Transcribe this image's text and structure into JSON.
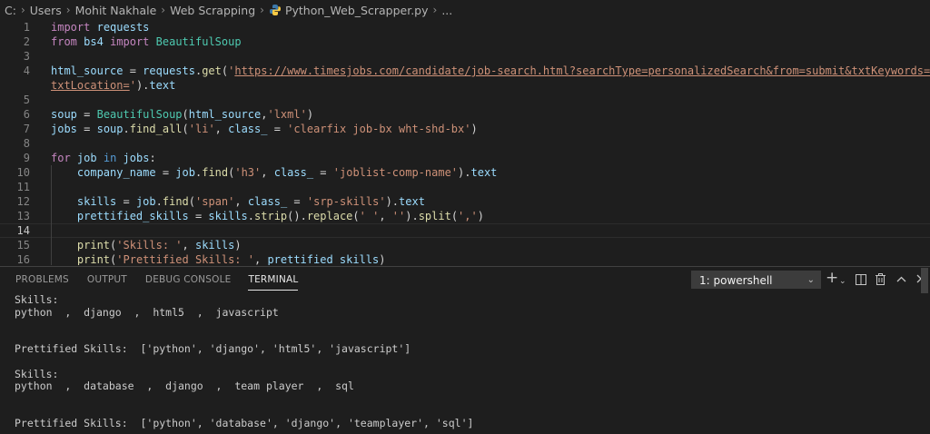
{
  "breadcrumb": {
    "segments": [
      "C:",
      "Users",
      "Mohit Nakhale",
      "Web Scrapping",
      "Python_Web_Scrapper.py",
      "..."
    ]
  },
  "editor": {
    "active_line": 14,
    "lines": [
      {
        "n": "1",
        "t": [
          [
            "k",
            "import"
          ],
          [
            "p",
            " "
          ],
          [
            "v",
            "requests"
          ]
        ]
      },
      {
        "n": "2",
        "t": [
          [
            "k",
            "from"
          ],
          [
            "p",
            " "
          ],
          [
            "v",
            "bs4"
          ],
          [
            "p",
            " "
          ],
          [
            "k",
            "import"
          ],
          [
            "p",
            " "
          ],
          [
            "c",
            "BeautifulSoup"
          ]
        ]
      },
      {
        "n": "3",
        "t": []
      },
      {
        "n": "4",
        "t": [
          [
            "v",
            "html_source"
          ],
          [
            "p",
            " = "
          ],
          [
            "v",
            "requests"
          ],
          [
            "p",
            "."
          ],
          [
            "f",
            "get"
          ],
          [
            "p",
            "("
          ],
          [
            "s",
            "'"
          ],
          [
            "su",
            "https://www.timesjobs.com/candidate/job-search.html?searchType=personalizedSearch&from=submit&txtKeywords=Python&"
          ]
        ]
      },
      {
        "n": "",
        "t": [
          [
            "su",
            "txtLocation="
          ],
          [
            "s",
            "'"
          ],
          [
            "p",
            ")."
          ],
          [
            "v",
            "text"
          ]
        ]
      },
      {
        "n": "5",
        "t": []
      },
      {
        "n": "6",
        "t": [
          [
            "v",
            "soup"
          ],
          [
            "p",
            " = "
          ],
          [
            "c",
            "BeautifulSoup"
          ],
          [
            "p",
            "("
          ],
          [
            "v",
            "html_source"
          ],
          [
            "p",
            ","
          ],
          [
            "s",
            "'lxml'"
          ],
          [
            "p",
            ")"
          ]
        ]
      },
      {
        "n": "7",
        "t": [
          [
            "v",
            "jobs"
          ],
          [
            "p",
            " = "
          ],
          [
            "v",
            "soup"
          ],
          [
            "p",
            "."
          ],
          [
            "f",
            "find_all"
          ],
          [
            "p",
            "("
          ],
          [
            "s",
            "'li'"
          ],
          [
            "p",
            ", "
          ],
          [
            "v",
            "class_"
          ],
          [
            "p",
            " = "
          ],
          [
            "s",
            "'clearfix job-bx wht-shd-bx'"
          ],
          [
            "p",
            ")"
          ]
        ]
      },
      {
        "n": "8",
        "t": []
      },
      {
        "n": "9",
        "t": [
          [
            "k",
            "for"
          ],
          [
            "p",
            " "
          ],
          [
            "v",
            "job"
          ],
          [
            "p",
            " "
          ],
          [
            "kb",
            "in"
          ],
          [
            "p",
            " "
          ],
          [
            "v",
            "jobs"
          ],
          [
            "p",
            ":"
          ]
        ]
      },
      {
        "n": "10",
        "t": [
          [
            "p",
            "    "
          ],
          [
            "v",
            "company_name"
          ],
          [
            "p",
            " = "
          ],
          [
            "v",
            "job"
          ],
          [
            "p",
            "."
          ],
          [
            "f",
            "find"
          ],
          [
            "p",
            "("
          ],
          [
            "s",
            "'h3'"
          ],
          [
            "p",
            ", "
          ],
          [
            "v",
            "class_"
          ],
          [
            "p",
            " = "
          ],
          [
            "s",
            "'joblist-comp-name'"
          ],
          [
            "p",
            ")."
          ],
          [
            "v",
            "text"
          ]
        ]
      },
      {
        "n": "11",
        "t": []
      },
      {
        "n": "12",
        "t": [
          [
            "p",
            "    "
          ],
          [
            "v",
            "skills"
          ],
          [
            "p",
            " = "
          ],
          [
            "v",
            "job"
          ],
          [
            "p",
            "."
          ],
          [
            "f",
            "find"
          ],
          [
            "p",
            "("
          ],
          [
            "s",
            "'span'"
          ],
          [
            "p",
            ", "
          ],
          [
            "v",
            "class_"
          ],
          [
            "p",
            " = "
          ],
          [
            "s",
            "'srp-skills'"
          ],
          [
            "p",
            ")."
          ],
          [
            "v",
            "text"
          ]
        ]
      },
      {
        "n": "13",
        "t": [
          [
            "p",
            "    "
          ],
          [
            "v",
            "prettified_skills"
          ],
          [
            "p",
            " = "
          ],
          [
            "v",
            "skills"
          ],
          [
            "p",
            "."
          ],
          [
            "f",
            "strip"
          ],
          [
            "p",
            "()."
          ],
          [
            "f",
            "replace"
          ],
          [
            "p",
            "("
          ],
          [
            "s",
            "' '"
          ],
          [
            "p",
            ", "
          ],
          [
            "s",
            "''"
          ],
          [
            "p",
            ")."
          ],
          [
            "f",
            "split"
          ],
          [
            "p",
            "("
          ],
          [
            "s",
            "','"
          ],
          [
            "p",
            ")"
          ]
        ]
      },
      {
        "n": "14",
        "t": []
      },
      {
        "n": "15",
        "t": [
          [
            "p",
            "    "
          ],
          [
            "f",
            "print"
          ],
          [
            "p",
            "("
          ],
          [
            "s",
            "'Skills: '"
          ],
          [
            "p",
            ", "
          ],
          [
            "v",
            "skills"
          ],
          [
            "p",
            ")"
          ]
        ]
      },
      {
        "n": "16",
        "t": [
          [
            "p",
            "    "
          ],
          [
            "f",
            "print"
          ],
          [
            "p",
            "("
          ],
          [
            "s",
            "'Prettified Skills: '"
          ],
          [
            "p",
            ", "
          ],
          [
            "v",
            "prettified_skills"
          ],
          [
            "p",
            ")"
          ]
        ]
      }
    ]
  },
  "panel": {
    "tabs": [
      "PROBLEMS",
      "OUTPUT",
      "DEBUG CONSOLE",
      "TERMINAL"
    ],
    "active_tab": "TERMINAL",
    "terminal_select": "1: powershell",
    "tool_icons": [
      "plus-icon",
      "chevron-down-icon",
      "split-icon",
      "trash-icon",
      "chevron-up-icon",
      "close-icon"
    ]
  },
  "terminal": {
    "lines": [
      "Skills:",
      "python  ,  django  ,  html5  ,  javascript",
      "",
      "",
      "Prettified Skills:  ['python', 'django', 'html5', 'javascript']",
      "",
      "Skills:",
      "python  ,  database  ,  django  ,  team player  ,  sql",
      "",
      "",
      "Prettified Skills:  ['python', 'database', 'django', 'teamplayer', 'sql']"
    ]
  },
  "colors": {
    "background": "#1e1e1e",
    "keyword": "#c586c0",
    "string": "#ce9178",
    "function": "#dcdcaa",
    "variable": "#9cdcfe",
    "class": "#4ec9b0"
  }
}
